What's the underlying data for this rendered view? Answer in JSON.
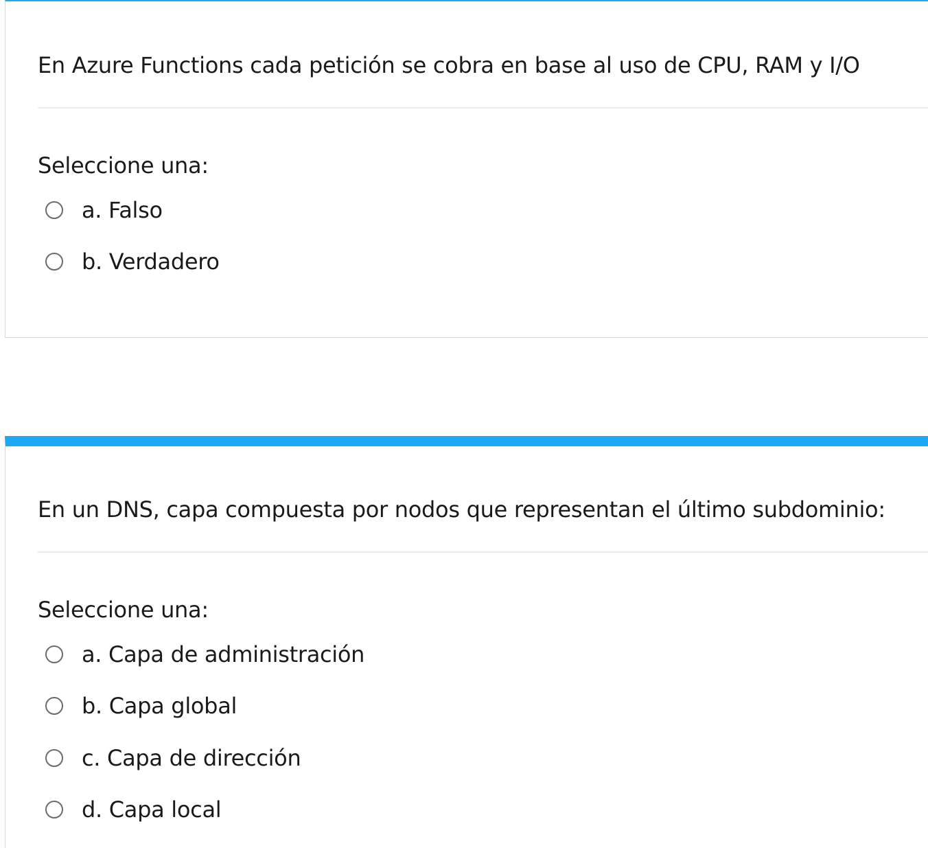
{
  "questions": [
    {
      "text": "En Azure Functions cada petición se cobra en base al uso de CPU, RAM y I/O",
      "prompt": "Seleccione una:",
      "options": [
        {
          "label": "a. Falso"
        },
        {
          "label": "b. Verdadero"
        }
      ]
    },
    {
      "text": "En un DNS, capa compuesta por nodos que representan el último subdominio:",
      "prompt": "Seleccione una:",
      "options": [
        {
          "label": "a. Capa de administración"
        },
        {
          "label": "b. Capa global"
        },
        {
          "label": "c. Capa de dirección"
        },
        {
          "label": "d. Capa local"
        }
      ]
    }
  ],
  "colors": {
    "accent": "#1ea7f2",
    "border": "#d9d9d9",
    "divider": "#ececec",
    "radio": "#6b6b6b"
  },
  "icons": {
    "radio": "radio-unselected-icon"
  }
}
